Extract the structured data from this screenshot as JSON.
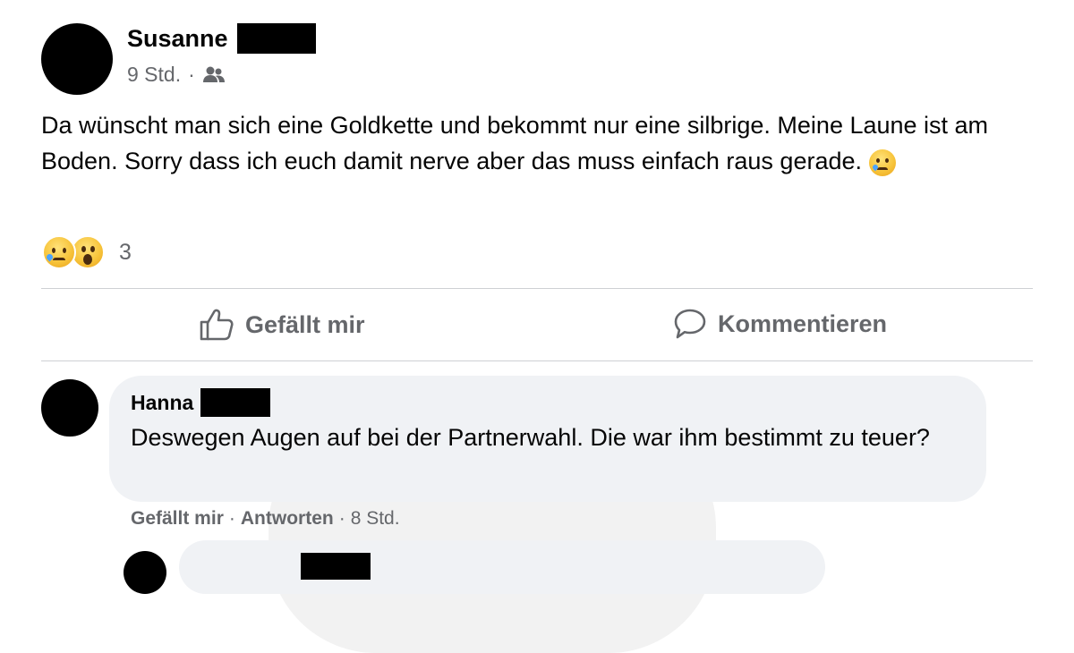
{
  "post": {
    "author": "Susanne",
    "time": "9 Std.",
    "separator": "·",
    "audience_icon": "friends-icon",
    "text": "Da wünscht man sich eine Goldkette und bekommt nur eine silbrige. Meine Laune ist am Boden. Sorry dass ich euch damit nerve aber das muss einfach raus gerade.",
    "text_emoji": "sad-tear-emoji",
    "reactions": {
      "icons": [
        "sad-reaction-icon",
        "wow-reaction-icon"
      ],
      "count": "3"
    }
  },
  "actions": {
    "like_label": "Gefällt mir",
    "comment_label": "Kommentieren"
  },
  "comments": [
    {
      "author": "Hanna",
      "text": "Deswegen Augen auf bei der Partnerwahl. Die war ihm bestimmt zu teuer?",
      "like_label": "Gefällt mir",
      "reply_label": "Antworten",
      "time": "8 Std.",
      "dot": "·"
    }
  ],
  "colors": {
    "text": "#050505",
    "secondary": "#65676b",
    "bubble": "#f0f2f5",
    "divider": "#ced0d4"
  }
}
